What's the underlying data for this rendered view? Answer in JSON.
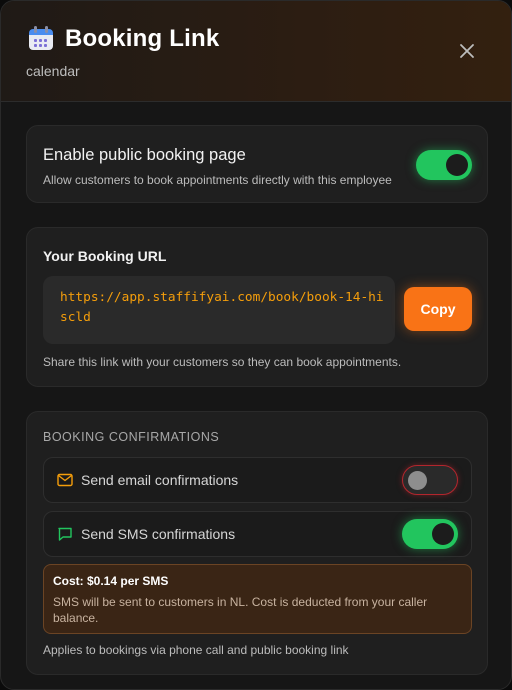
{
  "header": {
    "title": "Booking Link",
    "subtitle": "calendar"
  },
  "public_booking": {
    "label": "Enable public booking page",
    "description": "Allow customers to book appointments directly with this employee",
    "enabled": true
  },
  "booking_url": {
    "label": "Your Booking URL",
    "url": "https://app.staffifyai.com/book/book-14-hiscld",
    "copy_label": "Copy",
    "help": "Share this link with your customers so they can book appointments."
  },
  "confirmations": {
    "section_label": "BOOKING CONFIRMATIONS",
    "email": {
      "label": "Send email confirmations",
      "enabled": false,
      "icon": "mail-icon"
    },
    "sms": {
      "label": "Send SMS confirmations",
      "enabled": true,
      "icon": "message-icon"
    },
    "cost": {
      "title": "Cost: $0.14 per SMS",
      "body": "SMS will be sent to customers in NL. Cost is deducted from your caller balance."
    },
    "footer": "Applies to bookings via phone call and public booking link"
  },
  "colors": {
    "accent": "#f97316",
    "toggle_on": "#22c55e",
    "toggle_off_border": "#b3262d",
    "url_text": "#f59e0b"
  }
}
